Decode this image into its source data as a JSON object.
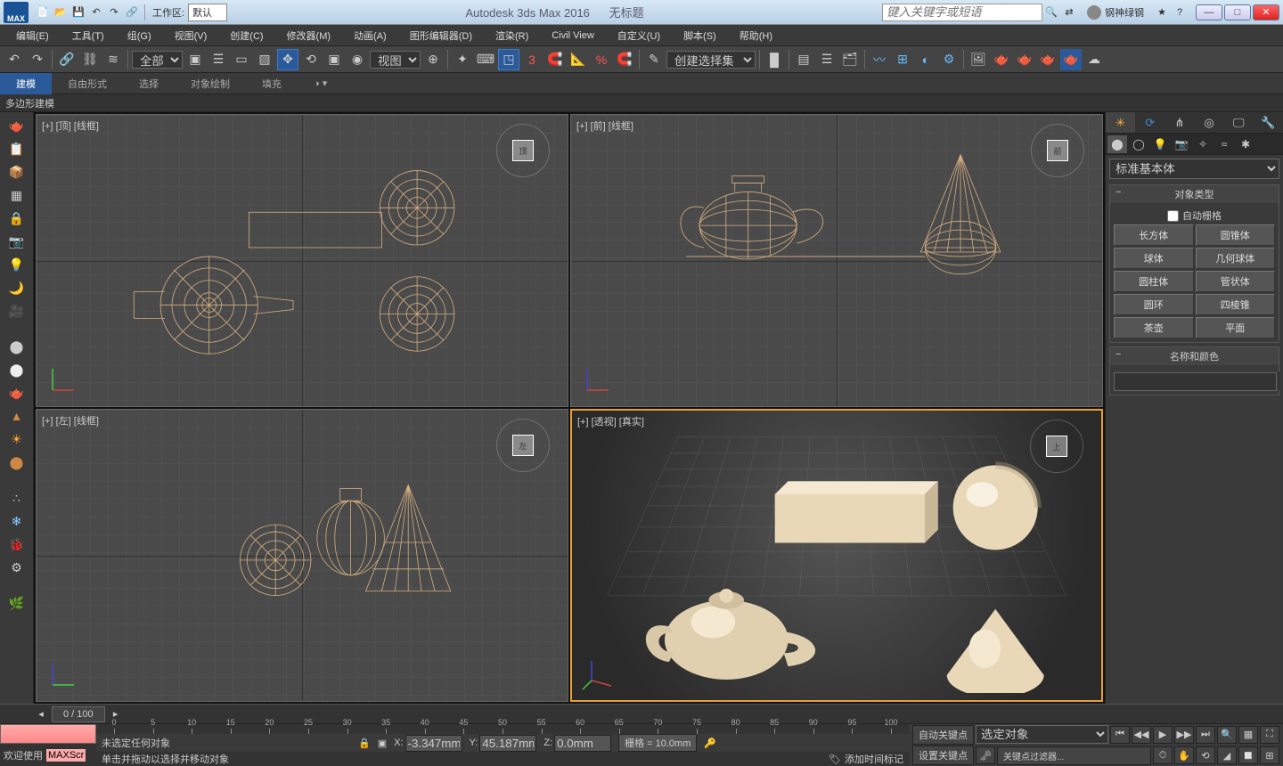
{
  "titlebar": {
    "workspace_label": "工作区: ",
    "workspace_value": "默认",
    "app_title": "Autodesk 3ds Max 2016",
    "doc_title": "无标题",
    "search_placeholder": "键入关键字或短语",
    "username": "钢神绿钢"
  },
  "menus": [
    "编辑(E)",
    "工具(T)",
    "组(G)",
    "视图(V)",
    "创建(C)",
    "修改器(M)",
    "动画(A)",
    "图形编辑器(D)",
    "渲染(R)",
    "Civil View",
    "自定义(U)",
    "脚本(S)",
    "帮助(H)"
  ],
  "toolbar": {
    "select_filter": "全部",
    "refcoord": "视图",
    "named_sel": "创建选择集"
  },
  "ribbon": {
    "tabs": [
      "建模",
      "自由形式",
      "选择",
      "对象绘制",
      "填充"
    ],
    "sub": "多边形建模"
  },
  "viewports": {
    "tl": "[+] [顶] [线框]",
    "tr": "[+] [前] [线框]",
    "bl": "[+] [左] [线框]",
    "br": "[+] [透视] [真实]",
    "cube_tl": "顶",
    "cube_tr": "前",
    "cube_bl": "左",
    "cube_br": "上"
  },
  "createpanel": {
    "dropdown": "标准基本体",
    "rollout_objtype": "对象类型",
    "autogrid": "自动栅格",
    "buttons": [
      "长方体",
      "圆锥体",
      "球体",
      "几何球体",
      "圆柱体",
      "管状体",
      "圆环",
      "四棱锥",
      "茶壶",
      "平面"
    ],
    "rollout_name": "名称和颜色"
  },
  "timeslider": {
    "frame": "0 / 100"
  },
  "trackbar_ticks": [
    0,
    5,
    10,
    15,
    20,
    25,
    30,
    35,
    40,
    45,
    50,
    55,
    60,
    65,
    70,
    75,
    80,
    85,
    90,
    95,
    100
  ],
  "status": {
    "welcome": "欢迎使用",
    "listener": "MAXScr",
    "selection": "未选定任何对象",
    "prompt": "单击并拖动以选择并移动对象",
    "x_label": "X:",
    "x_val": "-3.347mm",
    "y_label": "Y:",
    "y_val": "45.187mm",
    "z_label": "Z:",
    "z_val": "0.0mm",
    "grid": "栅格 = 10.0mm",
    "addtime": "添加时间标记",
    "autokey": "自动关键点",
    "setkey": "设置关键点",
    "keyfilters": "关键点过滤器...",
    "selobj": "选定对象"
  }
}
